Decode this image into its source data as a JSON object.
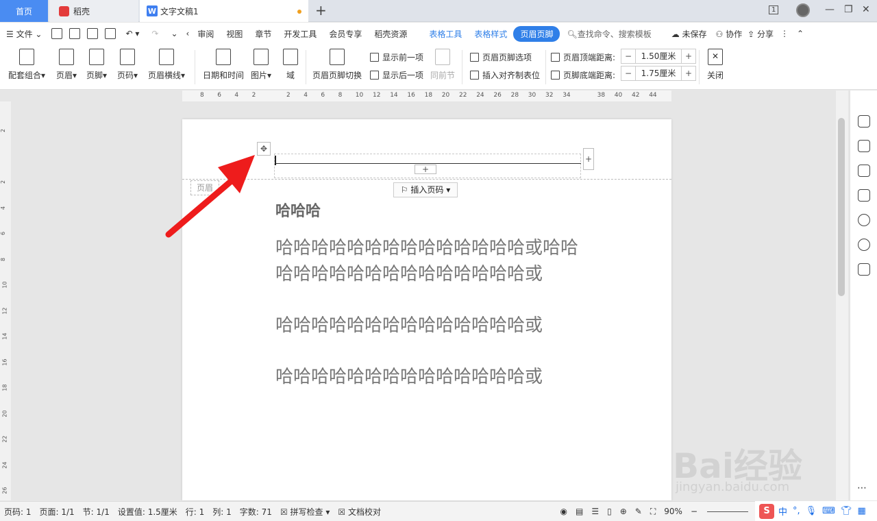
{
  "tabs": {
    "home": "首页",
    "daoke": "稻壳",
    "doc": "文字文稿1",
    "add": "+"
  },
  "window": {
    "page_indicator": "1",
    "minimize": "—",
    "restore": "❐",
    "close": "✕"
  },
  "menu": {
    "file": "文件",
    "items": [
      "审阅",
      "视图",
      "章节",
      "开发工具",
      "会员专享",
      "稻壳资源"
    ],
    "context": [
      "表格工具",
      "表格样式"
    ],
    "active": "页眉页脚",
    "search": "查找命令、搜索模板",
    "unsaved": "未保存",
    "collab": "协作",
    "share": "分享"
  },
  "ribbon": {
    "set_combo": "配套组合",
    "header": "页眉",
    "footer": "页脚",
    "pagenum": "页码",
    "header_line": "页眉横线",
    "datetime": "日期和时间",
    "picture": "图片",
    "field": "域",
    "switch": "页眉页脚切换",
    "show_prev": "显示前一项",
    "show_next": "显示后一项",
    "same_prev": "同前节",
    "options": "页眉页脚选项",
    "insert_align": "插入对齐制表位",
    "top_label": "页眉顶端距离:",
    "top_value": "1.50厘米",
    "bottom_label": "页脚底端距离:",
    "bottom_value": "1.75厘米",
    "close": "关闭"
  },
  "ruler": {
    "h": [
      "8",
      "6",
      "4",
      "2",
      "",
      "2",
      "4",
      "6",
      "8",
      "10",
      "12",
      "14",
      "16",
      "18",
      "20",
      "22",
      "24",
      "26",
      "28",
      "30",
      "32",
      "34",
      "",
      "38",
      "40",
      "42",
      "44"
    ],
    "v": [
      "2",
      "",
      "2",
      "4",
      "6",
      "8",
      "10",
      "12",
      "14",
      "16",
      "18",
      "20",
      "22",
      "24",
      "26"
    ]
  },
  "document": {
    "header_tag": "页眉",
    "insert_page_num": "插入页码",
    "heading": "哈哈哈",
    "paragraphs": [
      "哈哈哈哈哈哈哈哈哈哈哈哈哈哈或哈哈哈哈哈哈哈哈哈哈哈哈哈哈哈哈或",
      "哈哈哈哈哈哈哈哈哈哈哈哈哈哈或",
      "哈哈哈哈哈哈哈哈哈哈哈哈哈哈或"
    ]
  },
  "status": {
    "page": "页码: 1",
    "pages": "页面: 1/1",
    "section": "节: 1/1",
    "setting": "设置值: 1.5厘米",
    "row": "行: 1",
    "col": "列: 1",
    "words": "字数: 71",
    "spell": "拼写检查",
    "proof": "文档校对",
    "zoom": "90%"
  },
  "watermark": {
    "main": "Bai经验",
    "sub": "jingyan.baidu.com"
  },
  "ime": {
    "lang": "中"
  }
}
